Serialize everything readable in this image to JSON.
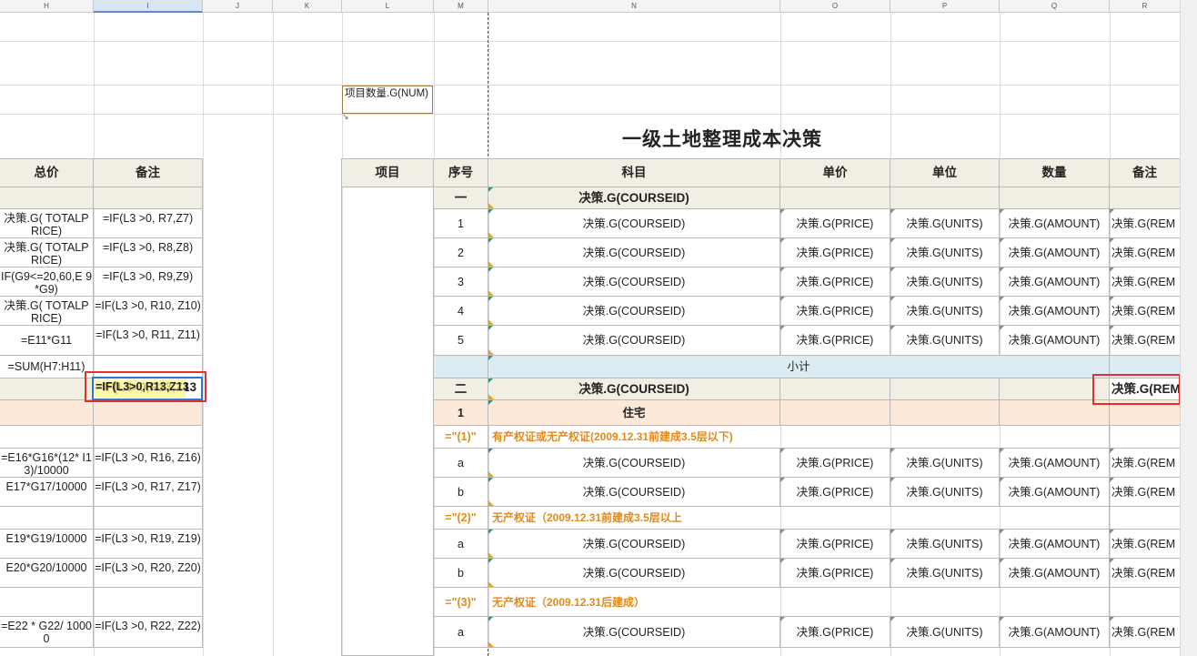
{
  "columns": [
    "H",
    "I",
    "J",
    "K",
    "L",
    "M",
    "N",
    "O",
    "P",
    "Q",
    "R"
  ],
  "selected_column": "I",
  "title": "一级土地整理成本决策",
  "comment_box": "项目数量.G(NUM)",
  "comment_arrow": "↘",
  "left_headers": {
    "total": "总价",
    "note": "备注"
  },
  "right_headers": {
    "item": "项目",
    "seq": "序号",
    "subject": "科目",
    "price": "单价",
    "unit": "单位",
    "qty": "数量",
    "note": "备注"
  },
  "left_rows": [
    {
      "total": "",
      "note": ""
    },
    {
      "total": "决策.G( TOTALPRICE)",
      "note": "=IF(L3 >0, R7,Z7)"
    },
    {
      "total": "决策.G( TOTALPRICE)",
      "note": "=IF(L3 >0, R8,Z8)"
    },
    {
      "total": "IF(G9<=20,60,E 9*G9)",
      "note": "=IF(L3 >0, R9,Z9)"
    },
    {
      "total": "决策.G( TOTALPRICE)",
      "note": "=IF(L3 >0, R10, Z10)"
    },
    {
      "total": "=E11*G11",
      "note": "=IF(L3 >0, R11, Z11)"
    },
    {
      "total": "=SUM(H7:H11)",
      "note": ""
    },
    {
      "total": "",
      "note": "=IF(L3>0,R13,Z13"
    },
    {
      "total": "",
      "note": ""
    },
    {
      "total": "",
      "note": ""
    },
    {
      "total": "=E16*G16*(12* I13)/10000",
      "note": "=IF(L3 >0, R16, Z16)"
    },
    {
      "total": "E17*G17/10000",
      "note": "=IF(L3 >0, R17, Z17)"
    },
    {
      "total": "",
      "note": ""
    },
    {
      "total": "E19*G19/10000",
      "note": "=IF(L3 >0, R19, Z19)"
    },
    {
      "total": "E20*G20/10000",
      "note": "=IF(L3 >0, R20, Z20)"
    },
    {
      "total": "",
      "note": ""
    },
    {
      "total": "=E22 * G22/ 10000",
      "note": "=IF(L3 >0, R22, Z22)"
    }
  ],
  "right_rows": [
    {
      "kind": "sec",
      "seq": "一",
      "subject": "决策.G(COURSEID)",
      "price": "",
      "unit": "",
      "qty": "",
      "note": ""
    },
    {
      "kind": "row",
      "seq": "1",
      "subject": "决策.G(COURSEID)",
      "price": "决策.G(PRICE)",
      "unit": "决策.G(UNITS)",
      "qty": "决策.G(AMOUNT)",
      "note": "决策.G(REM"
    },
    {
      "kind": "row",
      "seq": "2",
      "subject": "决策.G(COURSEID)",
      "price": "决策.G(PRICE)",
      "unit": "决策.G(UNITS)",
      "qty": "决策.G(AMOUNT)",
      "note": "决策.G(REM"
    },
    {
      "kind": "row",
      "seq": "3",
      "subject": "决策.G(COURSEID)",
      "price": "决策.G(PRICE)",
      "unit": "决策.G(UNITS)",
      "qty": "决策.G(AMOUNT)",
      "note": "决策.G(REM"
    },
    {
      "kind": "row",
      "seq": "4",
      "subject": "决策.G(COURSEID)",
      "price": "决策.G(PRICE)",
      "unit": "决策.G(UNITS)",
      "qty": "决策.G(AMOUNT)",
      "note": "决策.G(REM"
    },
    {
      "kind": "row",
      "seq": "5",
      "subject": "决策.G(COURSEID)",
      "price": "决策.G(PRICE)",
      "unit": "决策.G(UNITS)",
      "qty": "决策.G(AMOUNT)",
      "note": "决策.G(REM"
    },
    {
      "kind": "sub",
      "seq": "",
      "subject": "小计",
      "price": "",
      "unit": "",
      "qty": "",
      "note": ""
    },
    {
      "kind": "sec",
      "seq": "二",
      "subject": "决策.G(COURSEID)",
      "price": "",
      "unit": "",
      "qty": "",
      "note": "决策.G(REM"
    },
    {
      "kind": "peach",
      "seq": "1",
      "subject": "住宅",
      "price": "",
      "unit": "",
      "qty": "",
      "note": ""
    },
    {
      "kind": "orange",
      "seq": "=\"(1)\"",
      "subject": "有产权证或无产权证(2009.12.31前建成3.5层以下)",
      "price": "",
      "unit": "",
      "qty": "",
      "note": ""
    },
    {
      "kind": "row",
      "seq": "a",
      "subject": "决策.G(COURSEID)",
      "price": "决策.G(PRICE)",
      "unit": "决策.G(UNITS)",
      "qty": "决策.G(AMOUNT)",
      "note": "决策.G(REM"
    },
    {
      "kind": "row",
      "seq": "b",
      "subject": "决策.G(COURSEID)",
      "price": "决策.G(PRICE)",
      "unit": "决策.G(UNITS)",
      "qty": "决策.G(AMOUNT)",
      "note": "决策.G(REM"
    },
    {
      "kind": "orange",
      "seq": "=\"(2)\"",
      "subject": "无产权证（2009.12.31前建成3.5层以上",
      "price": "",
      "unit": "",
      "qty": "",
      "note": ""
    },
    {
      "kind": "row",
      "seq": "a",
      "subject": "决策.G(COURSEID)",
      "price": "决策.G(PRICE)",
      "unit": "决策.G(UNITS)",
      "qty": "决策.G(AMOUNT)",
      "note": "决策.G(REM"
    },
    {
      "kind": "row",
      "seq": "b",
      "subject": "决策.G(COURSEID)",
      "price": "决策.G(PRICE)",
      "unit": "决策.G(UNITS)",
      "qty": "决策.G(AMOUNT)",
      "note": "决策.G(REM"
    },
    {
      "kind": "orange",
      "seq": "=\"(3)\"",
      "subject": "无产权证（2009.12.31后建成）",
      "price": "",
      "unit": "",
      "qty": "",
      "note": ""
    },
    {
      "kind": "row",
      "seq": "a",
      "subject": "决策.G(COURSEID)",
      "price": "决策.G(PRICE)",
      "unit": "决策.G(UNITS)",
      "qty": "决策.G(AMOUNT)",
      "note": "决策.G(REM"
    }
  ],
  "colors": {
    "header_bg": "#f1efe3",
    "subtotal_bg": "#dcecf2",
    "peach_bg": "#fde9d9",
    "orange_text": "#e28a1b",
    "highlight_red": "#e03030",
    "selection_blue": "#2e75d6"
  }
}
